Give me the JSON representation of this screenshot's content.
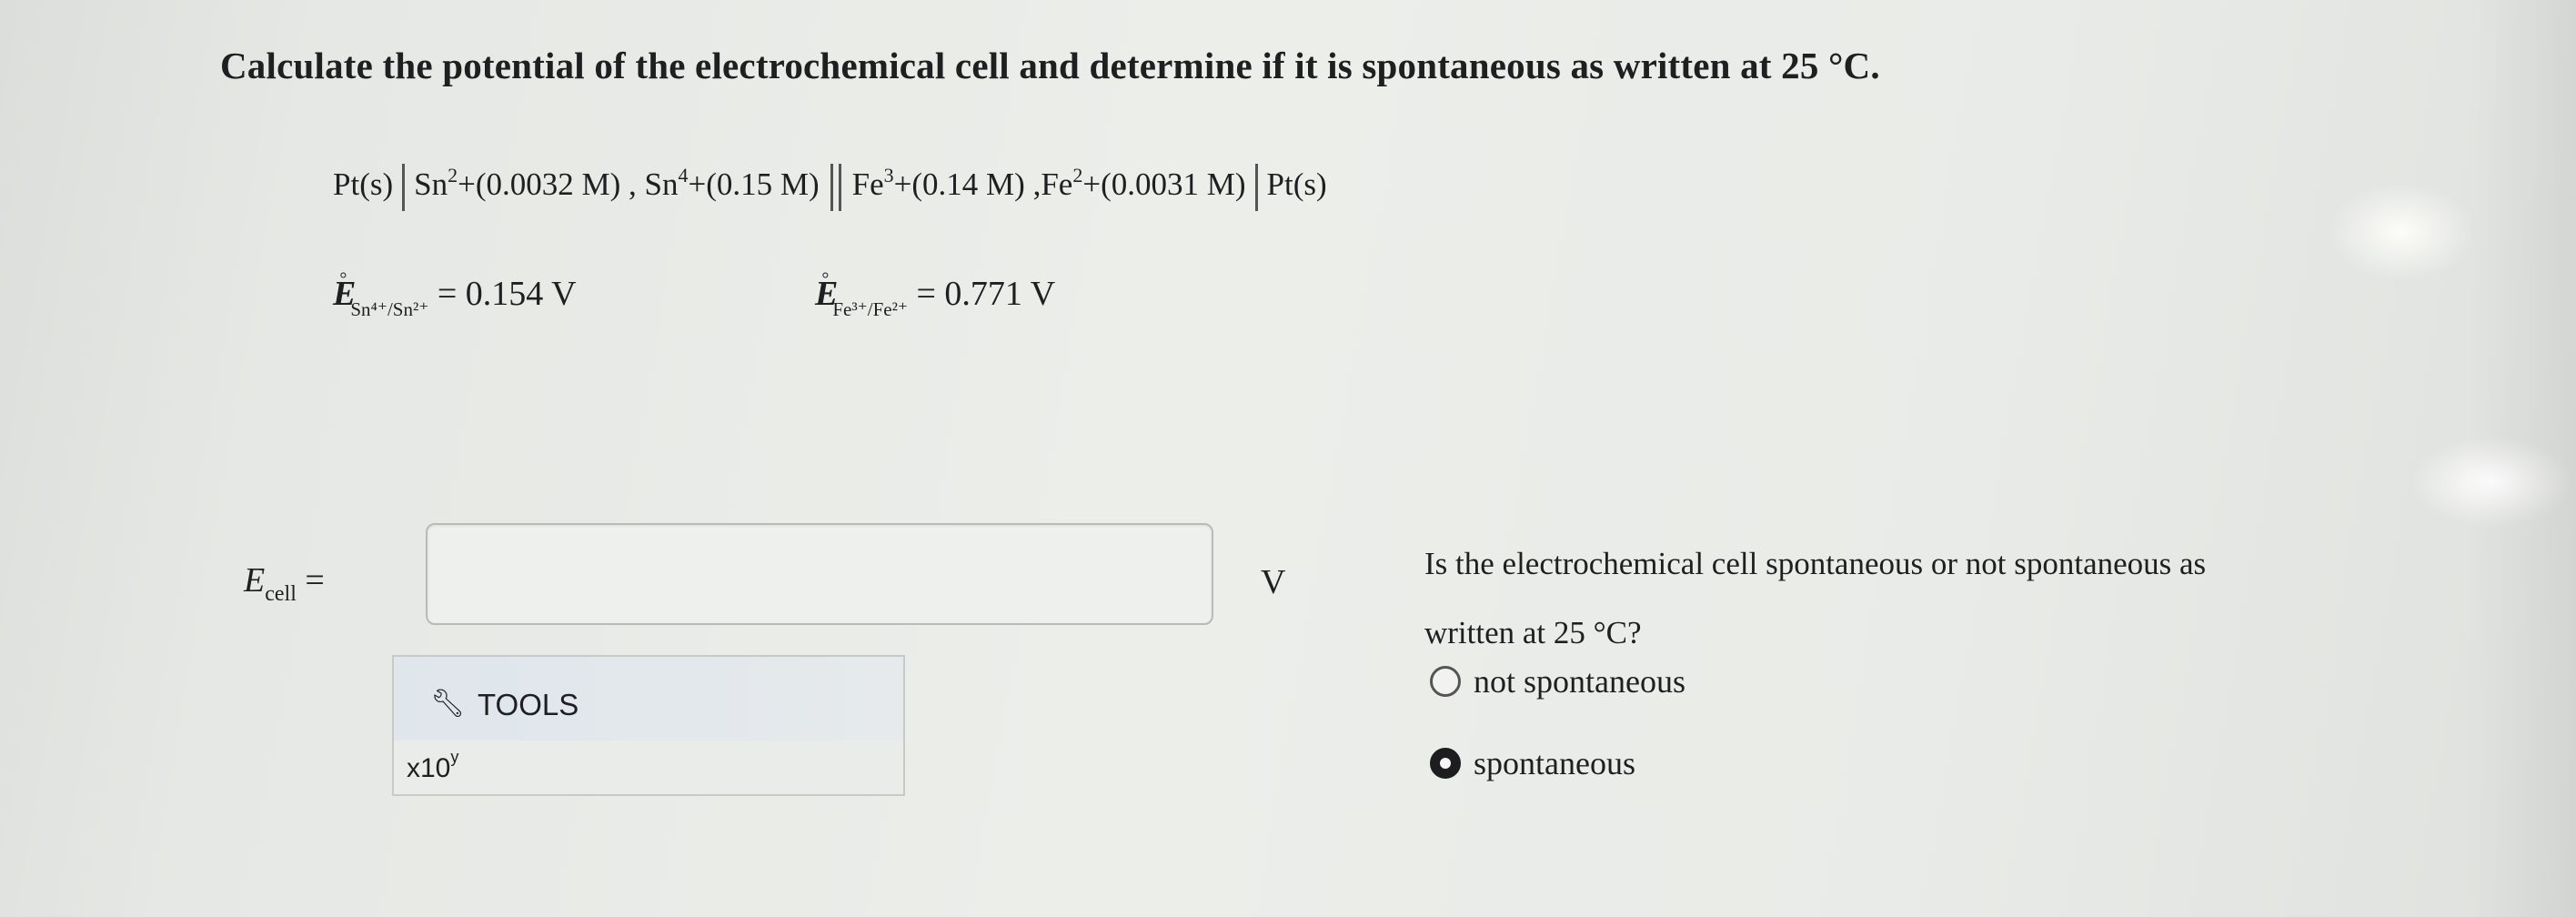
{
  "question": "Calculate the potential of the electrochemical cell and determine if it is spontaneous as written at 25 °C.",
  "cell": {
    "anode_electrode": "Pt(s)",
    "sp1": "Sn",
    "sp1_charge": "2",
    "sp1_rest": "+(0.0032 M) ,",
    "sp2": "Sn",
    "sp2_charge": "4",
    "sp2_rest": "+(0.15 M)",
    "sp3": "Fe",
    "sp3_charge": "3",
    "sp3_rest": "+(0.14 M) ,",
    "sp4": "Fe",
    "sp4_charge": "2",
    "sp4_rest": "+(0.0031 M)",
    "cathode_electrode": "Pt(s)"
  },
  "potentials": {
    "e1_symbol": "E",
    "e1_sub": "Sn⁴⁺/Sn²⁺",
    "e1_value": "= 0.154 V",
    "e2_symbol": "E",
    "e2_sub": "Fe³⁺/Fe²⁺",
    "e2_value": "= 0.771 V",
    "degree": "°"
  },
  "answer": {
    "label_symbol": "E",
    "label_sub": "cell",
    "label_eq": "=",
    "value": "",
    "unit": "V"
  },
  "tools": {
    "icon": "wrench-icon",
    "label": "TOOLS",
    "sci_base": "x10",
    "sci_exp": "y"
  },
  "spontaneity": {
    "question": "Is the electrochemical cell spontaneous or not spontaneous as written at 25 °C?",
    "options": [
      {
        "label": "not spontaneous",
        "selected": false
      },
      {
        "label": "spontaneous",
        "selected": true
      }
    ]
  }
}
